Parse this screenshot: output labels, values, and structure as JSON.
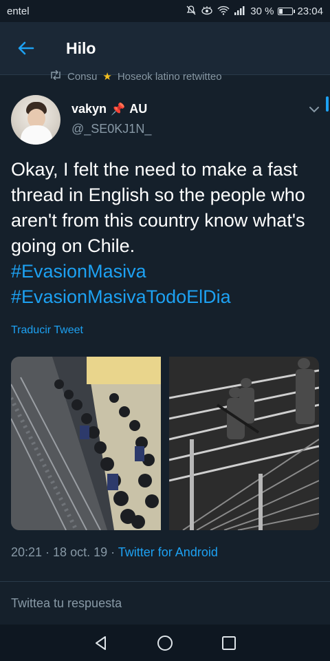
{
  "status_bar": {
    "carrier": "entel",
    "battery": "30 %",
    "battery_level": 0.3,
    "time": "23:04",
    "icons": [
      "mute-icon",
      "eye-comfort-icon",
      "wifi-icon",
      "signal-icon",
      "battery-icon"
    ]
  },
  "app_bar": {
    "back_icon": "arrow-left-icon",
    "title": "Hilo"
  },
  "retweet": {
    "icon": "retweet-icon",
    "user_prefix": "Consu",
    "emoji": "★",
    "user_suffix": "Hoseok latino retwitteo"
  },
  "tweet": {
    "author_name": "vakyn",
    "author_emoji": "📌",
    "author_suffix": "AU",
    "handle": "@_SE0KJ1N_",
    "text": "Okay, I felt the need to make a fast thread in English so the people who aren't from this country know what's going on Chile.",
    "hashtags": [
      "#EvasionMasiva",
      "#EvasionMasivaTodoElDia"
    ],
    "translate_label": "Traducir Tweet",
    "timestamp": "20:21 · 18 oct. 19 · ",
    "source": "Twitter for Android"
  },
  "reply": {
    "placeholder": "Twittea tu respuesta"
  },
  "nav": {
    "icons": [
      "back-triangle-icon",
      "home-circle-icon",
      "recents-square-icon"
    ]
  },
  "colors": {
    "background": "#15202b",
    "accent": "#1da1f2",
    "secondary_text": "#8899a6"
  }
}
